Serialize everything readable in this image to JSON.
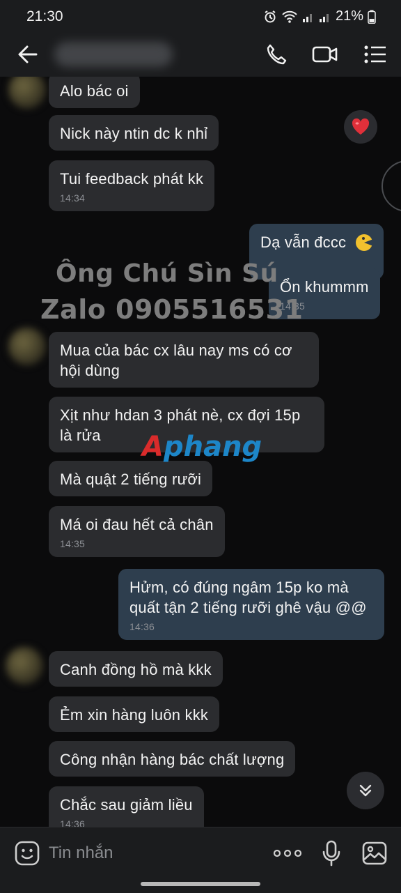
{
  "status_bar": {
    "time": "21:30",
    "battery": "21%"
  },
  "header": {
    "contact_name": ""
  },
  "watermarks": {
    "line1": "Ông Chú Sìn Sú",
    "line2": "Zalo 0905516531",
    "logo_a": "A",
    "logo_rest": "phang"
  },
  "messages": [
    {
      "text": "Alo bác oi",
      "time": ""
    },
    {
      "text": "Nick này ntin dc k nhỉ",
      "time": ""
    },
    {
      "text": "Tui feedback phát kk",
      "time": "14:34"
    },
    {
      "text": "Dạ vẫn đccc",
      "time": ""
    },
    {
      "text": "Ổn khummm",
      "time": "14:35"
    },
    {
      "text": "Mua của bác cx lâu nay ms có cơ\nhội dùng",
      "time": ""
    },
    {
      "text": "Xịt như hdan 3 phát nè, cx đợi 15p\nlà rửa",
      "time": ""
    },
    {
      "text": "Mà quật 2 tiếng rưỡi",
      "time": ""
    },
    {
      "text": "Má oi đau hết cả chân",
      "time": "14:35"
    },
    {
      "text": "Hửm, có đúng ngâm 15p ko mà\nquất tận 2 tiếng rưỡi ghê vậu @@",
      "time": "14:36"
    },
    {
      "text": "Canh đồng hồ mà kkk",
      "time": ""
    },
    {
      "text": "Ẻm xin hàng luôn kkk",
      "time": ""
    },
    {
      "text": "Công nhận hàng bác chất lượng",
      "time": ""
    },
    {
      "text": "Chắc sau giảm liều",
      "time": "14:36"
    }
  ],
  "composer": {
    "placeholder": "Tin nhắn"
  },
  "icons": {
    "back": "arrow-left-icon",
    "call": "phone-icon",
    "video": "video-camera-icon",
    "menu": "list-menu-icon",
    "reaction": "heart-icon",
    "scroll": "double-chevron-down-icon",
    "emoji": "smiley-icon",
    "more": "more-dots-icon",
    "mic": "microphone-icon",
    "gallery": "image-gallery-icon"
  },
  "colors": {
    "incoming_bubble": "#2b2c2f",
    "outgoing_bubble": "#2e3e4e",
    "heart": "#e0303a"
  }
}
